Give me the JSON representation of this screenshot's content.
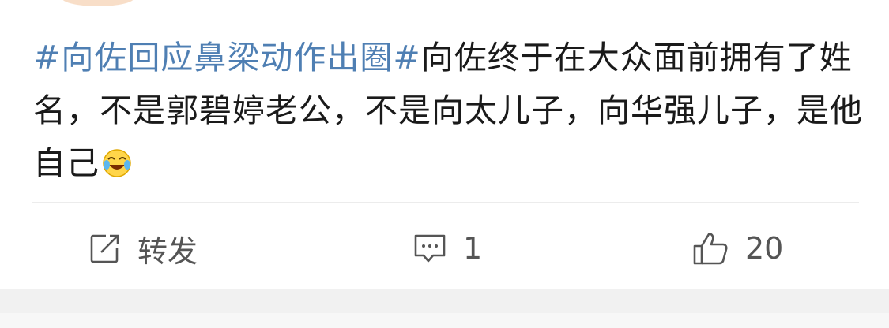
{
  "post": {
    "hashtag": "#向佐回应鼻梁动作出圈#",
    "body": "向佐终于在大众面前拥有了姓名，不是郭碧婷老公，不是向太儿子，向华强儿子，是他自己",
    "emoji": "laughing-crying-emoji"
  },
  "actions": {
    "repost": {
      "label": "转发",
      "icon": "repost-icon"
    },
    "comment": {
      "count": "1",
      "icon": "comment-icon"
    },
    "like": {
      "count": "20",
      "icon": "thumbs-up-icon"
    }
  },
  "colors": {
    "hashtag": "#4f7fb3",
    "text": "#1a1a1a",
    "action": "#555555"
  }
}
